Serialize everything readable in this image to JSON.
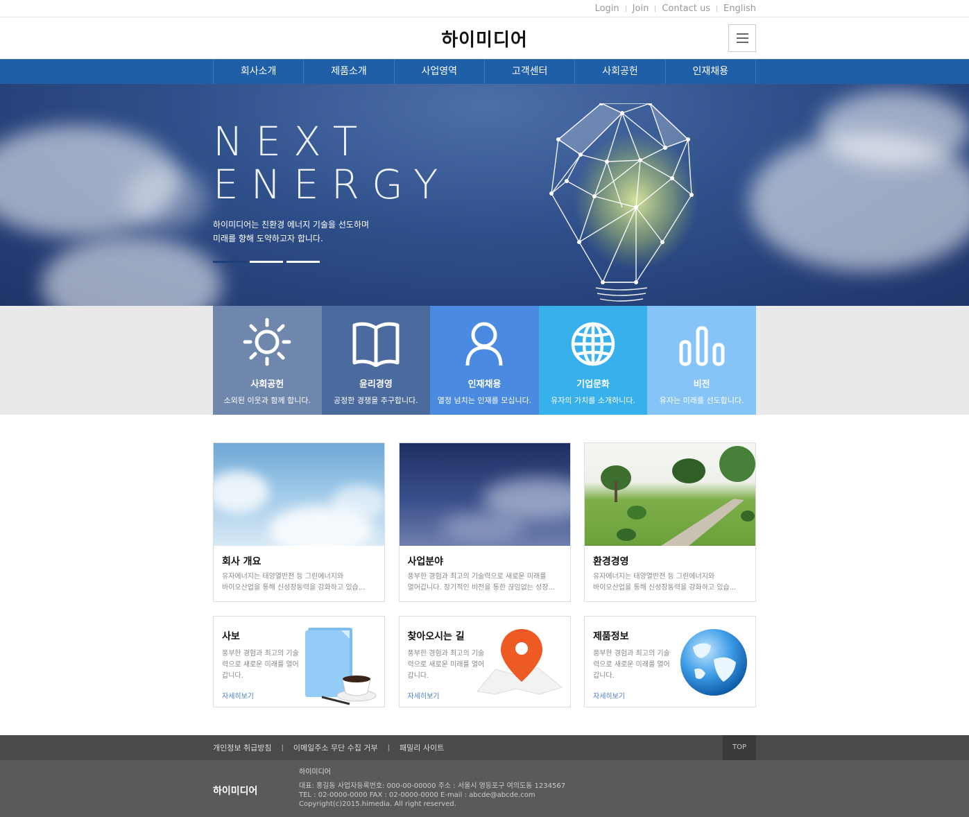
{
  "util_nav": [
    "Login",
    "Join",
    "Contact us",
    "English"
  ],
  "header": {
    "logo": "하이미디어",
    "menu_icon": "hamburger-icon"
  },
  "gnb": [
    "회사소개",
    "제품소개",
    "사업영역",
    "고객센터",
    "사회공헌",
    "인재채용"
  ],
  "hero": {
    "title_line1": "NEXT",
    "title_line2": "ENERGY",
    "sub_line1": "하이미디어는 친환경 에너지 기술을 선도하며",
    "sub_line2": "미래를 향해 도약하고자 합니다.",
    "slides": 3,
    "active_slide": 1
  },
  "quick": [
    {
      "title": "사회공헌",
      "desc": "소외된 이웃과 함께 합니다.",
      "icon": "sun-icon",
      "color": "#6f87ad"
    },
    {
      "title": "윤리경영",
      "desc": "공정한 경쟁을 추구합니다.",
      "icon": "book-icon",
      "color": "#4b6a9d"
    },
    {
      "title": "인재채용",
      "desc": "열정 넘치는 인재를 모십니다.",
      "icon": "person-icon",
      "color": "#4a8ae0"
    },
    {
      "title": "기업문화",
      "desc": "유자의 가치를 소개하니다.",
      "icon": "globe-icon",
      "color": "#37b0ec"
    },
    {
      "title": "비전",
      "desc": "유자는 미래를 선도합니다.",
      "icon": "bar-chart-icon",
      "color": "#86c3f7"
    }
  ],
  "cards": [
    {
      "title": "회사 개요",
      "line1": "유자에너지는 태양열반전 등 그린에너지와",
      "line2": "바이오산업을 통해 신성장동력을 강화하고 있습..."
    },
    {
      "title": "사업분야",
      "line1": "풍부한 경험과 최고의 기술력으로 새로운 미래를",
      "line2": "열어갑니다. 장기적인 비전을 통한 끊임없는 성장..."
    },
    {
      "title": "환경경영",
      "line1": "유자에너지는 태양열반전 등 그린에너지와",
      "line2": "바이오산업을 통해 신성장동력을 강화하고 있습..."
    }
  ],
  "cards2": [
    {
      "title": "사보",
      "desc": "풍부한 경험과 최고의 기술력으로 새로운 미래를 열어갑니다.",
      "link": "자세히보기",
      "icon": "newsletter-coffee-icon"
    },
    {
      "title": "찾아오시는 길",
      "desc": "풍부한 경험과 최고의 기술력으로 새로운 미래를 열어갑니다.",
      "link": "자세히보기",
      "icon": "map-pin-icon"
    },
    {
      "title": "제품정보",
      "desc": "풍부한 경험과 최고의 기술력으로 새로운 미래를 열어갑니다.",
      "link": "자세히보기",
      "icon": "globe-icon"
    }
  ],
  "footer": {
    "links": [
      "개인정보 취급방침",
      "이메일주소 무단 수집 거부",
      "패밀리 사이트"
    ],
    "top_label": "TOP",
    "logo": "하이미디어",
    "company": "하이미디어",
    "info_line1": "대표: 홍길동    사업자등록번호: 000-00-00000    주소 : 서울시 영등포구 여의도동 1234567",
    "info_line2": "TEL : 02-0000-0000    FAX : 02-0000-0000    E-mail : abcde@abcde.com",
    "copyright": "Copyright(c)2015.himedia. All right reserved."
  }
}
